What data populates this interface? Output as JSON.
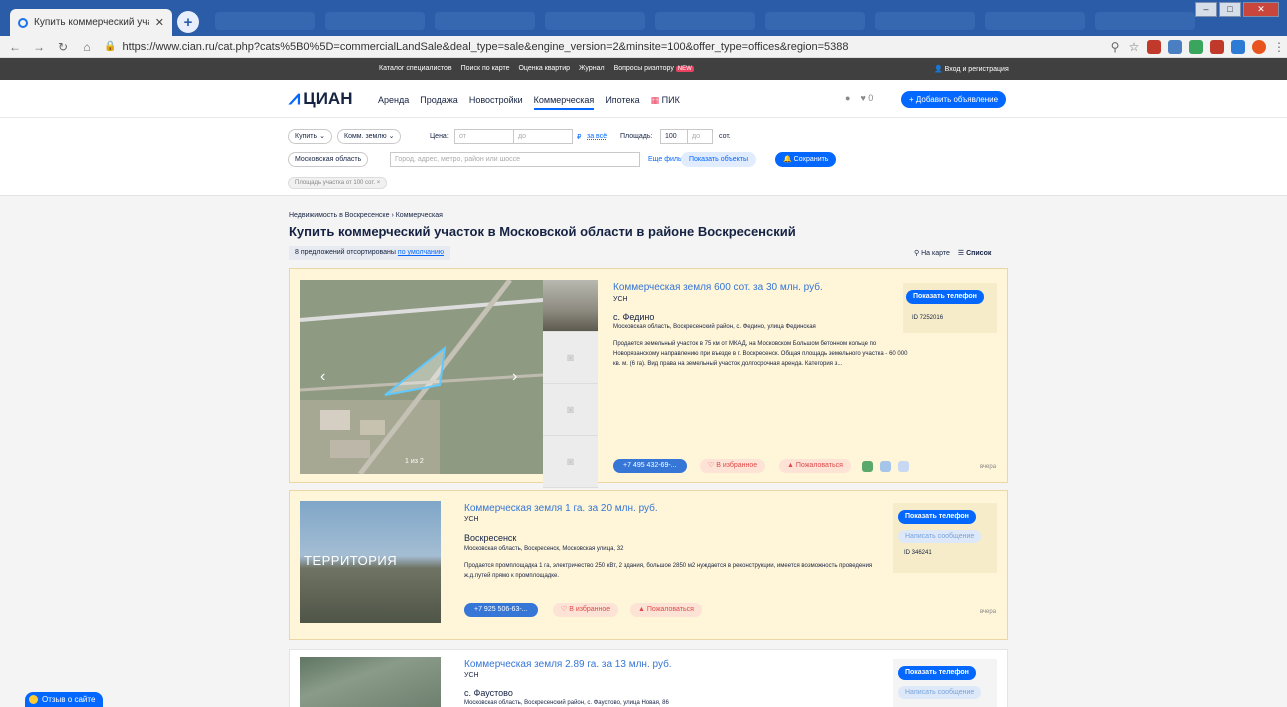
{
  "browser": {
    "tab_title": "Купить коммерческий участок",
    "url": "https://www.cian.ru/cat.php?cats%5B0%5D=commercialLandSale&deal_type=sale&engine_version=2&minsite=100&offer_type=offices&region=5388"
  },
  "topbar": {
    "links": [
      "Каталог специалистов",
      "Поиск по карте",
      "Оценка квартир",
      "Журнал",
      "Вопросы риэлтору"
    ],
    "new_badge": "NEW",
    "login": "Вход и регистрация"
  },
  "header": {
    "logo": "ЦИАН",
    "nav": [
      "Аренда",
      "Продажа",
      "Новостройки",
      "Коммерческая",
      "Ипотека",
      "ПИК"
    ],
    "fav_count": "0",
    "add_button": "+ Добавить объявление"
  },
  "filters": {
    "deal": "Купить",
    "type": "Комм. землю",
    "price_label": "Цена:",
    "price_from": "от",
    "price_to": "до",
    "currency": "₽",
    "price_per": "за всё",
    "area_label": "Площадь:",
    "area_from": "100",
    "area_to": "до",
    "area_unit": "сот.",
    "region": "Московская область",
    "search_placeholder": "Город, адрес, метро, район или шоссе",
    "more_filters": "Еще фильтры",
    "show_objects": "Показать объекты",
    "save": "Сохранить",
    "active_tag": "Площадь участка от 100 сот.  ×"
  },
  "content": {
    "breadcrumb_1": "Недвижимость в Воскресенске",
    "breadcrumb_2": "Коммерческая",
    "title": "Купить коммерческий участок в Московской области в районе Воскресенский",
    "sort_text": "8 предложений отсортированы",
    "sort_link": "по умолчанию",
    "view_map": "На карте",
    "view_list": "Список"
  },
  "listings": [
    {
      "title": "Коммерческая земля 600 сот. за 30 млн. руб.",
      "tax": "УСН",
      "location": "с. Федино",
      "address": "Московская область, Воскресенский район, с. Федино, улица Фединская",
      "description": "Продается земельный участок в 75 км от МКАД, на Московском Большом бетонном кольце по Новорязанскому направлению при въезде в г. Воскресенск. Общая площадь земельного участка - 60 000 кв. м. (6 га). Вид права на земельный участок долгосрочная аренда. Категория з...",
      "phone": "+7 495 432-69-...",
      "favorite": "В избранное",
      "complain": "Пожаловаться",
      "show_phone": "Показать телефон",
      "id": "ID 7252016",
      "date": "вчера",
      "photo_counter": "1 из 2"
    },
    {
      "title": "Коммерческая земля 1 га. за 20 млн. руб.",
      "tax": "УСН",
      "location": "Воскресенск",
      "address": "Московская область, Воскресенск, Московская улица, 32",
      "description": "Продается промплощадка 1 га, электричество 250 кВт, 2 здания, большое 2850 м2 нуждается в реконструкции, имеется возможность проведения ж.д.путей прямо к промплощадке.",
      "phone": "+7 925 506-63-...",
      "favorite": "В избранное",
      "complain": "Пожаловаться",
      "show_phone": "Показать телефон",
      "message": "Написать сообщение",
      "id": "ID 346241",
      "date": "вчера",
      "photo_text": "ТЕРРИТОРИЯ"
    },
    {
      "title": "Коммерческая земля 2.89 га. за 13 млн. руб.",
      "tax": "УСН",
      "location": "с. Фаустово",
      "address": "Московская область, Воскресенский район, с. Фаустово, улица Новая, 86",
      "show_phone": "Показать телефон",
      "message": "Написать сообщение"
    }
  ],
  "feedback": "Отзыв о сайте"
}
